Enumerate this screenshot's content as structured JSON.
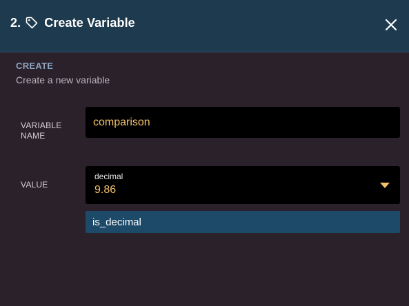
{
  "header": {
    "step": "2.",
    "title": "Create Variable",
    "icon": "tag-icon",
    "close_icon": "close-icon"
  },
  "section": {
    "title": "CREATE",
    "subtitle": "Create a new variable"
  },
  "fields": {
    "name_label": "VARIABLE NAME",
    "name_value": "comparison",
    "value_label": "VALUE",
    "value_type": "decimal",
    "value_number": "9.86"
  },
  "dropdown": {
    "options": [
      "is_decimal"
    ]
  },
  "colors": {
    "header_bg": "#1e3a4e",
    "body_bg": "#2b212b",
    "accent_text": "#f3c26a",
    "option_bg": "#1e4a6a",
    "section_title": "#8da3bf"
  }
}
